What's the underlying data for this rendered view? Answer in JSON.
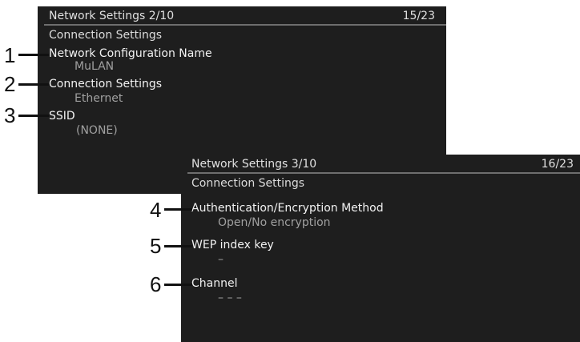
{
  "screen_a": {
    "title": "Network Settings 2/10",
    "counter": "15/23",
    "section": "Connection Settings",
    "items": [
      {
        "label": "Network Configuration Name",
        "value": "MuLAN"
      },
      {
        "label": "Connection Settings",
        "value": "Ethernet"
      },
      {
        "label": "SSID",
        "value": "(NONE)"
      }
    ]
  },
  "screen_b": {
    "title": "Network Settings 3/10",
    "counter": "16/23",
    "section": "Connection Settings",
    "items": [
      {
        "label": "Authentication/Encryption Method",
        "value": "Open/No encryption"
      },
      {
        "label": "WEP index key",
        "value": "–"
      },
      {
        "label": "Channel",
        "value": "– – –"
      }
    ]
  },
  "callouts": [
    "1",
    "2",
    "3",
    "4",
    "5",
    "6"
  ],
  "colors": {
    "screen_bg": "#1e1e1e",
    "label_text": "#f2f2f2",
    "value_text": "#a0a0a0",
    "callout": "#111111"
  }
}
